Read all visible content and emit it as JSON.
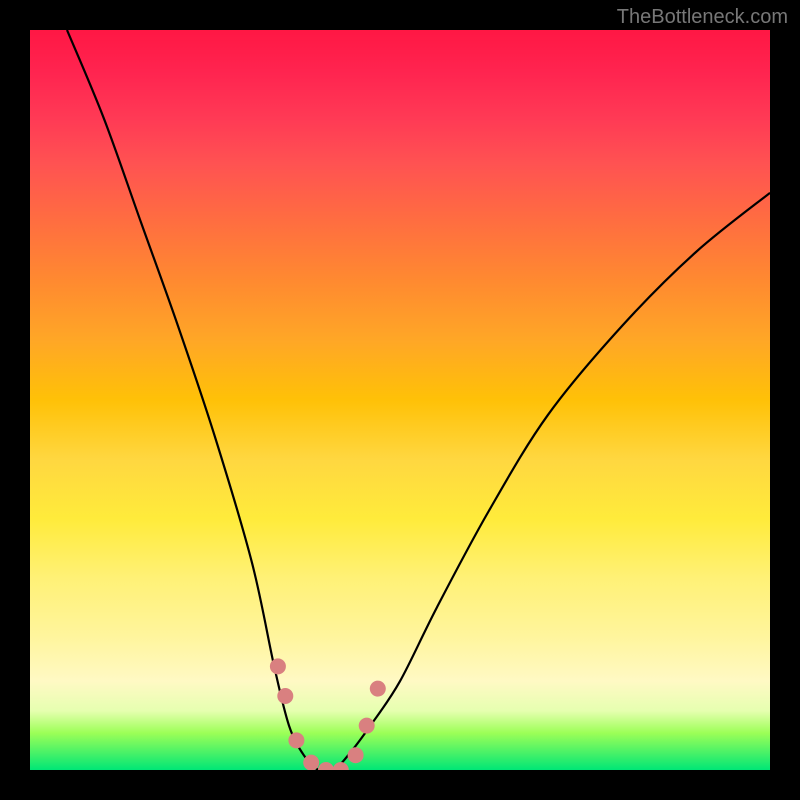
{
  "watermark": "TheBottleneck.com",
  "chart_data": {
    "type": "line",
    "title": "",
    "xlabel": "",
    "ylabel": "",
    "xlim": [
      0,
      100
    ],
    "ylim": [
      0,
      100
    ],
    "series": [
      {
        "name": "bottleneck-curve",
        "x": [
          5,
          10,
          15,
          20,
          25,
          30,
          33,
          35,
          37,
          39,
          41,
          43,
          46,
          50,
          55,
          62,
          70,
          80,
          90,
          100
        ],
        "values": [
          100,
          88,
          74,
          60,
          45,
          28,
          14,
          6,
          2,
          0,
          0,
          2,
          6,
          12,
          22,
          35,
          48,
          60,
          70,
          78
        ]
      }
    ],
    "markers": {
      "name": "pink-dots",
      "x": [
        33.5,
        34.5,
        36,
        38,
        40,
        42,
        44,
        45.5,
        47
      ],
      "values": [
        14,
        10,
        4,
        1,
        0,
        0,
        2,
        6,
        11
      ],
      "color": "#d98080",
      "size": 16
    },
    "gradient_stops": [
      {
        "pos": 0,
        "color": "#ff1744"
      },
      {
        "pos": 50,
        "color": "#ffc107"
      },
      {
        "pos": 100,
        "color": "#00e676"
      }
    ]
  }
}
